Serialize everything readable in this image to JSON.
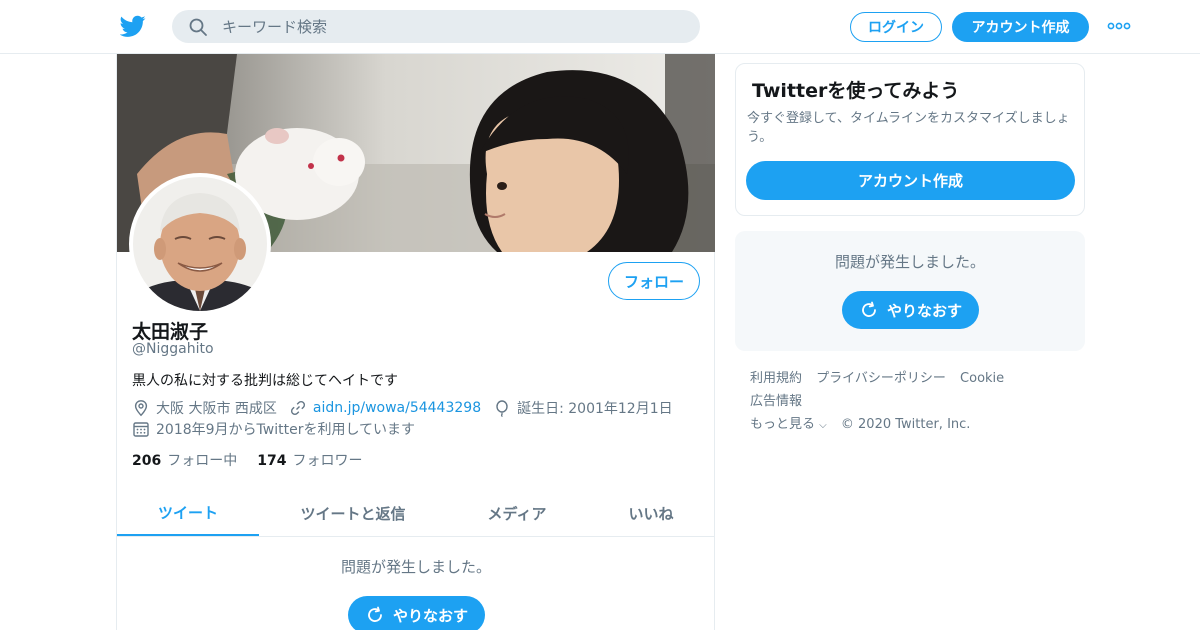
{
  "topbar": {
    "logo_icon": "twitter-bird-icon",
    "search_placeholder": "キーワード検索",
    "login_label": "ログイン",
    "signup_label": "アカウント作成",
    "more_icon": "more-dots-icon",
    "accent_color": "#1da1f2"
  },
  "profile": {
    "display_name": "太田淑子",
    "handle": "@Niggahito",
    "bio": "黒人の私に対する批判は総じてヘイトです",
    "location": "大阪 大阪市 西成区",
    "website": "aidn.jp/wowa/54443298",
    "birthday": "誕生日: 2001年12月1日",
    "joined": "2018年9月からTwitterを利用しています",
    "follow_label": "フォロー",
    "following_count": "206",
    "following_label": "フォロー中",
    "followers_count": "174",
    "followers_label": "フォロワー"
  },
  "tabs": [
    {
      "label": "ツイート",
      "active": true
    },
    {
      "label": "ツイートと返信",
      "active": false
    },
    {
      "label": "メディア",
      "active": false
    },
    {
      "label": "いいね",
      "active": false
    }
  ],
  "timeline": {
    "error_message": "問題が発生しました。",
    "retry_label": "やりなおす"
  },
  "sidebar": {
    "signup_card": {
      "title": "Twitterを使ってみよう",
      "description": "今すぐ登録して、タイムラインをカスタマイズしましょう。",
      "button_label": "アカウント作成"
    },
    "error_card": {
      "message": "問題が発生しました。",
      "retry_label": "やりなおす"
    },
    "footer": {
      "terms": "利用規約",
      "privacy": "プライバシーポリシー",
      "cookie": "Cookie",
      "ads": "広告情報",
      "more": "もっと見る",
      "copyright": "© 2020 Twitter, Inc."
    }
  }
}
